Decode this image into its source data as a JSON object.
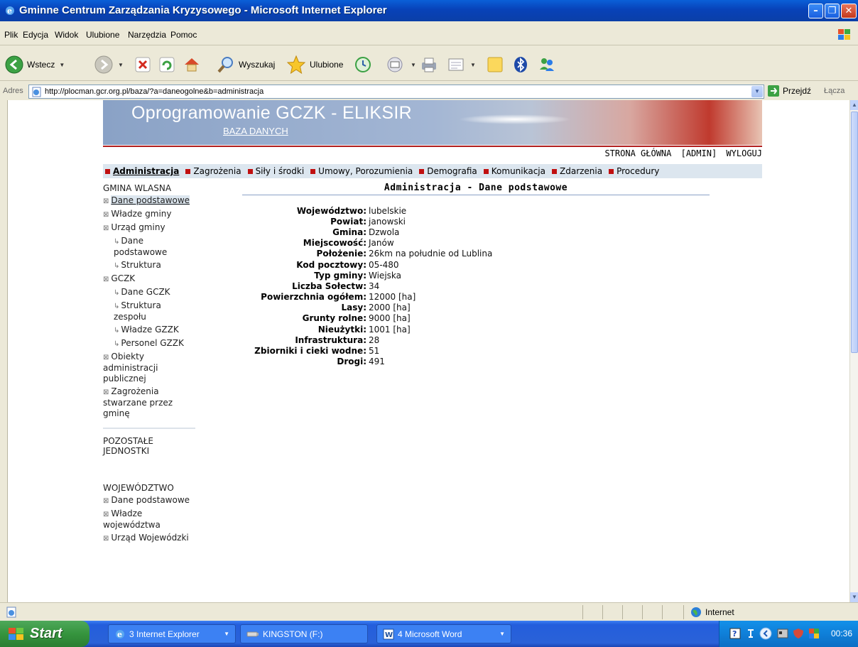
{
  "window": {
    "title": "Gminne Centrum Zarządzania Kryzysowego - Microsoft Internet Explorer"
  },
  "menu": [
    "Plik",
    "Edycja",
    "Widok",
    "Ulubione",
    "Narzędzia",
    "Pomoc"
  ],
  "toolbar": {
    "back": "Wstecz",
    "search": "Wyszukaj",
    "favorites": "Ulubione"
  },
  "address": {
    "label": "Adres",
    "url": "http://plocman.gcr.org.pl/baza/?a=daneogolne&b=administracja",
    "go": "Przejdź",
    "links": "Łącza"
  },
  "banner": {
    "title": "Oprogramowanie GCZK - ELIKSIR",
    "subtitle": "BAZA DANYCH"
  },
  "top_links": [
    "STRONA GŁÓWNA",
    "[ADMIN]",
    "WYLOGUJ"
  ],
  "nav": [
    "Administracja",
    "Zagrożenia",
    "Siły i środki",
    "Umowy, Porozumienia",
    "Demografia",
    "Komunikacja",
    "Zdarzenia",
    "Procedury"
  ],
  "sidebar": {
    "section1": "GMINA WLASNA",
    "items1": {
      "dane1": "Dane podstawowe",
      "wladze": "Władze gminy",
      "urzad": "Urząd gminy",
      "urzad_dane": "Dane podstawowe",
      "urzad_struktura": "Struktura",
      "gczk": "GCZK",
      "gczk_dane": "Dane GCZK",
      "gczk_struktura": "Struktura zespołu",
      "gczk_wladze": "Władze GZZK",
      "gczk_personel": "Personel GZZK",
      "obiekty": "Obiekty administracji publicznej",
      "zagrozenia": "Zagrożenia stwarzane przez gminę"
    },
    "section2": "POZOSTAŁE JEDNOSTKI",
    "section3": "WOJEWÓDZTWO",
    "items3": {
      "dane": "Dane podstawowe",
      "wladze": "Władze województwa",
      "urzad": "Urząd Wojewódzki"
    }
  },
  "content": {
    "title": "Administracja - Dane podstawowe",
    "rows": [
      {
        "k": "Województwo:",
        "v": "lubelskie"
      },
      {
        "k": "Powiat:",
        "v": "janowski"
      },
      {
        "k": "Gmina:",
        "v": "Dzwola"
      },
      {
        "k": "Miejscowość:",
        "v": "Janów"
      },
      {
        "k": "Położenie:",
        "v": "26km na południe od Lublina"
      },
      {
        "k": "Kod pocztowy:",
        "v": "05-480"
      },
      {
        "k": "Typ gminy:",
        "v": "Wiejska"
      },
      {
        "k": "Liczba Sołectw:",
        "v": "34"
      },
      {
        "k": "Powierzchnia ogółem:",
        "v": "12000 [ha]"
      },
      {
        "k": "Lasy:",
        "v": "2000 [ha]"
      },
      {
        "k": "Grunty rolne:",
        "v": "9000 [ha]"
      },
      {
        "k": "Nieużytki:",
        "v": "1001 [ha]"
      },
      {
        "k": "Infrastruktura:",
        "v": "28"
      },
      {
        "k": "Zbiorniki i cieki wodne:",
        "v": "51"
      },
      {
        "k": "Drogi:",
        "v": "491"
      }
    ]
  },
  "status": {
    "zone": "Internet"
  },
  "taskbar": {
    "start": "Start",
    "tasks": [
      "3 Internet Explorer",
      "KINGSTON (F:)",
      "4 Microsoft Word"
    ],
    "clock": "00:36"
  }
}
